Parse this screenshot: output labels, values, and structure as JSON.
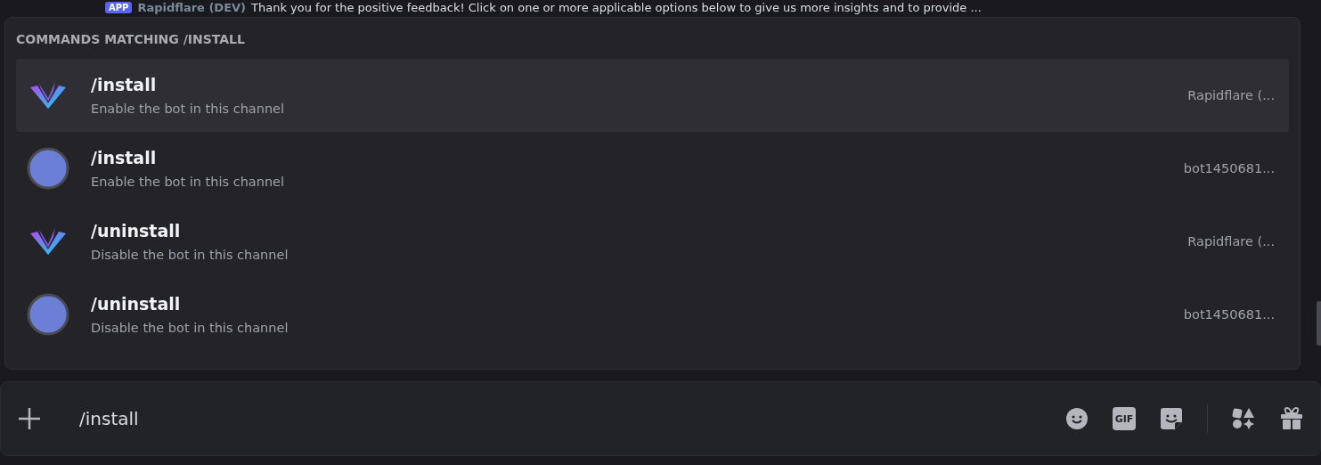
{
  "background_message": {
    "badge": "APP",
    "author": "Rapidflare (DEV)",
    "text": "Thank you for the positive feedback! Click on one or more applicable options below to give us more insights and to provide ..."
  },
  "popup": {
    "title": "COMMANDS MATCHING /INSTALL",
    "commands": [
      {
        "name": "/install",
        "description": "Enable the bot in this channel",
        "app": "Rapidflare (...",
        "kind": "logo",
        "selected": true
      },
      {
        "name": "/install",
        "description": "Enable the bot in this channel",
        "app": "bot1450681...",
        "kind": "default",
        "selected": false
      },
      {
        "name": "/uninstall",
        "description": "Disable the bot in this channel",
        "app": "Rapidflare (...",
        "kind": "logo",
        "selected": false
      },
      {
        "name": "/uninstall",
        "description": "Disable the bot in this channel",
        "app": "bot1450681...",
        "kind": "default",
        "selected": false
      }
    ]
  },
  "composer": {
    "value": "/install",
    "gif_label": "GIF"
  }
}
